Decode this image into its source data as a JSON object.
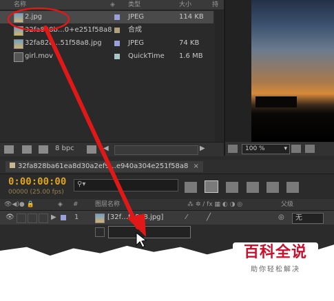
{
  "project": {
    "headers": {
      "name": "名称",
      "type": "类型",
      "size": "大小",
      "extra": "持"
    },
    "rows": [
      {
        "name": "2.jpg",
        "type": "JPEG",
        "size": "114 KB",
        "color": "#9aa0d8",
        "selected": true
      },
      {
        "name": "32fa828b…0+e251f58a8",
        "type": "合成",
        "size": "",
        "color": "#b0a080",
        "selected": false
      },
      {
        "name": "32fa828…51f58a8.jpg",
        "type": "JPEG",
        "size": "74 KB",
        "color": "#9aa0d8",
        "selected": false
      },
      {
        "name": "girl.mov",
        "type": "QuickTime",
        "size": "1.6 MB",
        "color": "#a8c8c8",
        "selected": false
      }
    ],
    "bpc": "8 bpc"
  },
  "viewer": {
    "zoom": "100 %"
  },
  "timeline": {
    "tab": "32fa828ba61ea8d30a2ef9…e940a304e251f58a8",
    "timecode": "0:00:00:00",
    "fps": "00000 (25.00 fps)",
    "col_layer_name": "图层名称",
    "col_parent": "父级",
    "layer_num": "1",
    "layer_name": "[32f…f58a8.jpg]",
    "parent_value": "无"
  },
  "watermark": {
    "title": "百科全说",
    "subtitle": "助你轻松解决"
  },
  "colors": {
    "timecode": "#e0a31e",
    "arrow": "#e01818"
  }
}
